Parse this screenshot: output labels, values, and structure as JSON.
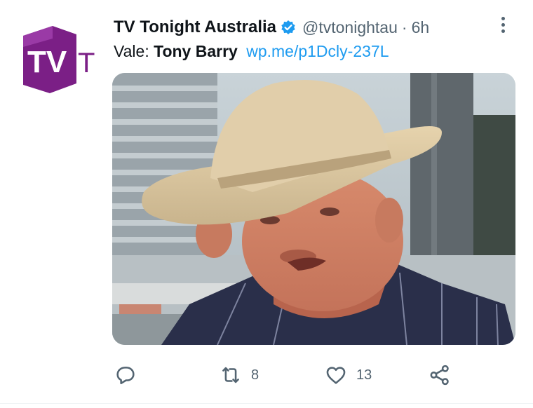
{
  "tweet": {
    "author_name": "TV Tonight Australia",
    "handle": "@tvtonightau",
    "separator": "·",
    "time": "6h",
    "text_prefix": "Vale: ",
    "text_bold": "Tony Barry",
    "link": "wp.me/p1Dcly-237L",
    "avatar_logo": "TVT",
    "avatar_icon": "tvt-logo-icon",
    "verified_icon": "verified-badge-icon",
    "more_icon": "more-options-icon",
    "media_icon": "photo-man-in-hat-image"
  },
  "actions": {
    "reply_icon": "reply-icon",
    "retweet_icon": "retweet-icon",
    "retweet_count": "8",
    "like_icon": "heart-icon",
    "like_count": "13",
    "share_icon": "share-icon"
  },
  "colors": {
    "link": "#1d9bf0",
    "verified": "#1d9bf0",
    "secondary_text": "#536471",
    "avatar_purple": "#7b1f86"
  }
}
